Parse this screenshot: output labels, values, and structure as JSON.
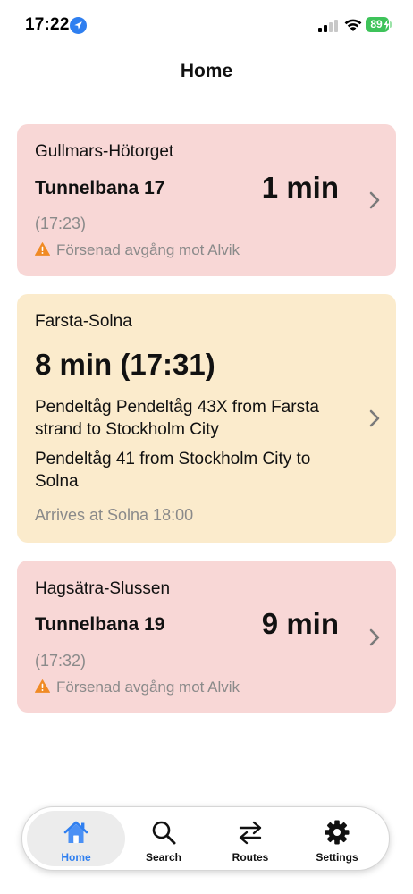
{
  "status_bar": {
    "time": "17:22",
    "battery": "89"
  },
  "header": {
    "title": "Home"
  },
  "cards": [
    {
      "route": "Gullmars-Hötorget",
      "line": "Tunnelbana 17",
      "minutes": "1 min",
      "departure": "(17:23)",
      "alert": "Försenad avgång mot Alvik"
    },
    {
      "route": "Farsta-Solna",
      "headline": "8 min (17:31)",
      "legs": [
        "Pendeltåg Pendeltåg 43X from Farsta strand to Stockholm City",
        "Pendeltåg 41 from Stockholm City to Solna"
      ],
      "arrives": "Arrives at Solna 18:00"
    },
    {
      "route": "Hagsätra-Slussen",
      "line": "Tunnelbana 19",
      "minutes": "9 min",
      "departure": "(17:32)",
      "alert": "Försenad avgång mot Alvik"
    }
  ],
  "tabs": [
    {
      "label": "Home",
      "icon": "house-icon",
      "active": true
    },
    {
      "label": "Search",
      "icon": "magnifier-icon",
      "active": false
    },
    {
      "label": "Routes",
      "icon": "arrows-swap-icon",
      "active": false
    },
    {
      "label": "Settings",
      "icon": "gear-icon",
      "active": false
    }
  ],
  "colors": {
    "delayed_card": "#f8d7d6",
    "route_card": "#fbebcc",
    "accent": "#2f7ff0",
    "warning": "#f08a24",
    "battery": "#3ec35a"
  }
}
